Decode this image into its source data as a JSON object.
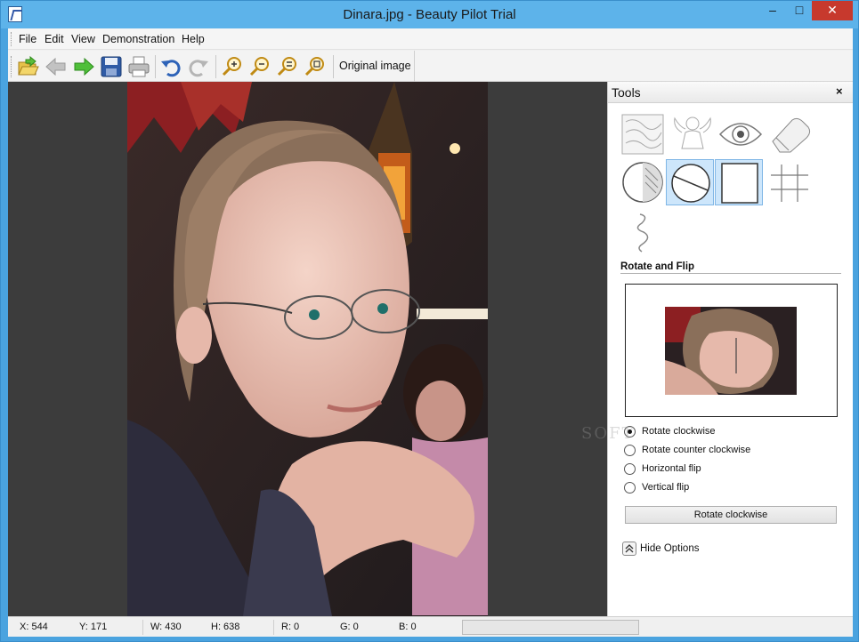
{
  "window": {
    "title": "Dinara.jpg - Beauty Pilot Trial",
    "min_glyph": "–",
    "max_glyph": "□",
    "close_glyph": "✕"
  },
  "menu": {
    "items": [
      "File",
      "Edit",
      "View",
      "Demonstration",
      "Help"
    ]
  },
  "toolbar": {
    "buttons": [
      "open-icon",
      "back-arrow-icon",
      "forward-arrow-icon",
      "save-icon",
      "print-icon",
      "undo-icon",
      "redo-icon",
      "zoom-in-icon",
      "zoom-out-icon",
      "zoom-fit-icon",
      "zoom-actual-icon"
    ],
    "original_image_label": "Original image"
  },
  "tools": {
    "title": "Tools",
    "close_glyph": "×",
    "icons": [
      "texture-tool-icon",
      "angel-tool-icon",
      "eye-tool-icon",
      "eraser-tool-icon",
      "contrast-tool-icon",
      "rotate-flip-tool-icon",
      "crop-tool-icon",
      "grid-tool-icon",
      "curve-tool-icon"
    ],
    "selected_index": 5,
    "section_title": "Rotate and Flip",
    "options": [
      {
        "label": "Rotate clockwise",
        "checked": true
      },
      {
        "label": "Rotate counter clockwise",
        "checked": false
      },
      {
        "label": "Horizontal flip",
        "checked": false
      },
      {
        "label": "Vertical flip",
        "checked": false
      }
    ],
    "action_button": "Rotate clockwise",
    "hide_options": "Hide Options",
    "watermark": "SOFT"
  },
  "status": {
    "x": "X: 544",
    "y": "Y: 171",
    "w": "W: 430",
    "h": "H: 638",
    "r": "R: 0",
    "g": "G: 0",
    "b": "B: 0"
  },
  "colors": {
    "accent": "#5db3ea",
    "close": "#c7392d",
    "selected_tool": "#cde6fb"
  }
}
